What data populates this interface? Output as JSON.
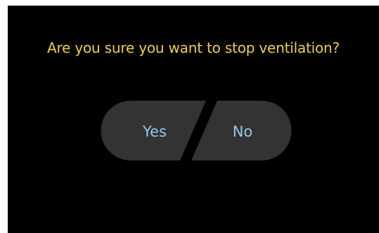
{
  "dialog": {
    "prompt": "Are you sure you want to stop ventilation?",
    "yes_label": "Yes",
    "no_label": "No"
  },
  "colors": {
    "background": "#000000",
    "prompt_text": "#f2cf3c",
    "button_fill": "#333333",
    "button_text": "#8ecbea"
  }
}
